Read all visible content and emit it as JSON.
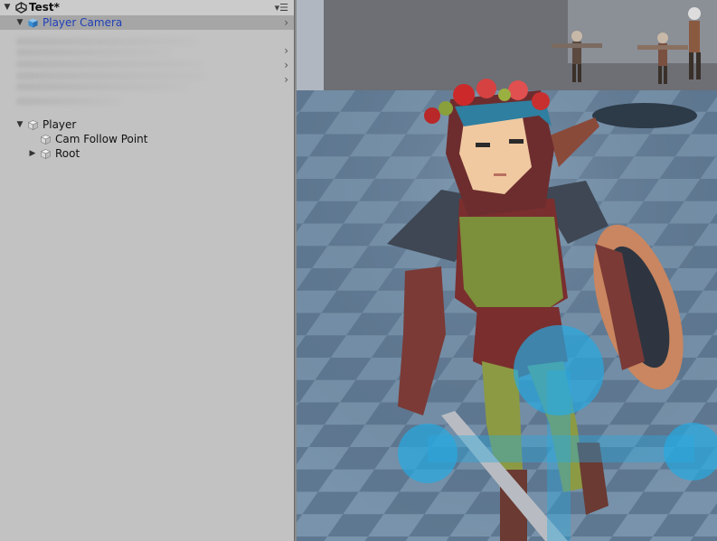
{
  "hierarchy": {
    "scene_title": "Test*",
    "items": [
      {
        "label": "Player Camera",
        "selected": true,
        "expanded": true,
        "icon": "cube-blue-icon"
      },
      {
        "label": "Player",
        "expanded": true,
        "icon": "cube-gray-icon"
      },
      {
        "label": "Cam Follow Point",
        "icon": "cube-gray-icon"
      },
      {
        "label": "Root",
        "collapsed": true,
        "icon": "cube-gray-icon"
      }
    ]
  },
  "colors": {
    "selection_text": "#1d3fb8",
    "panel_bg": "#c2c2c2",
    "joystick": "#27a9e1"
  }
}
